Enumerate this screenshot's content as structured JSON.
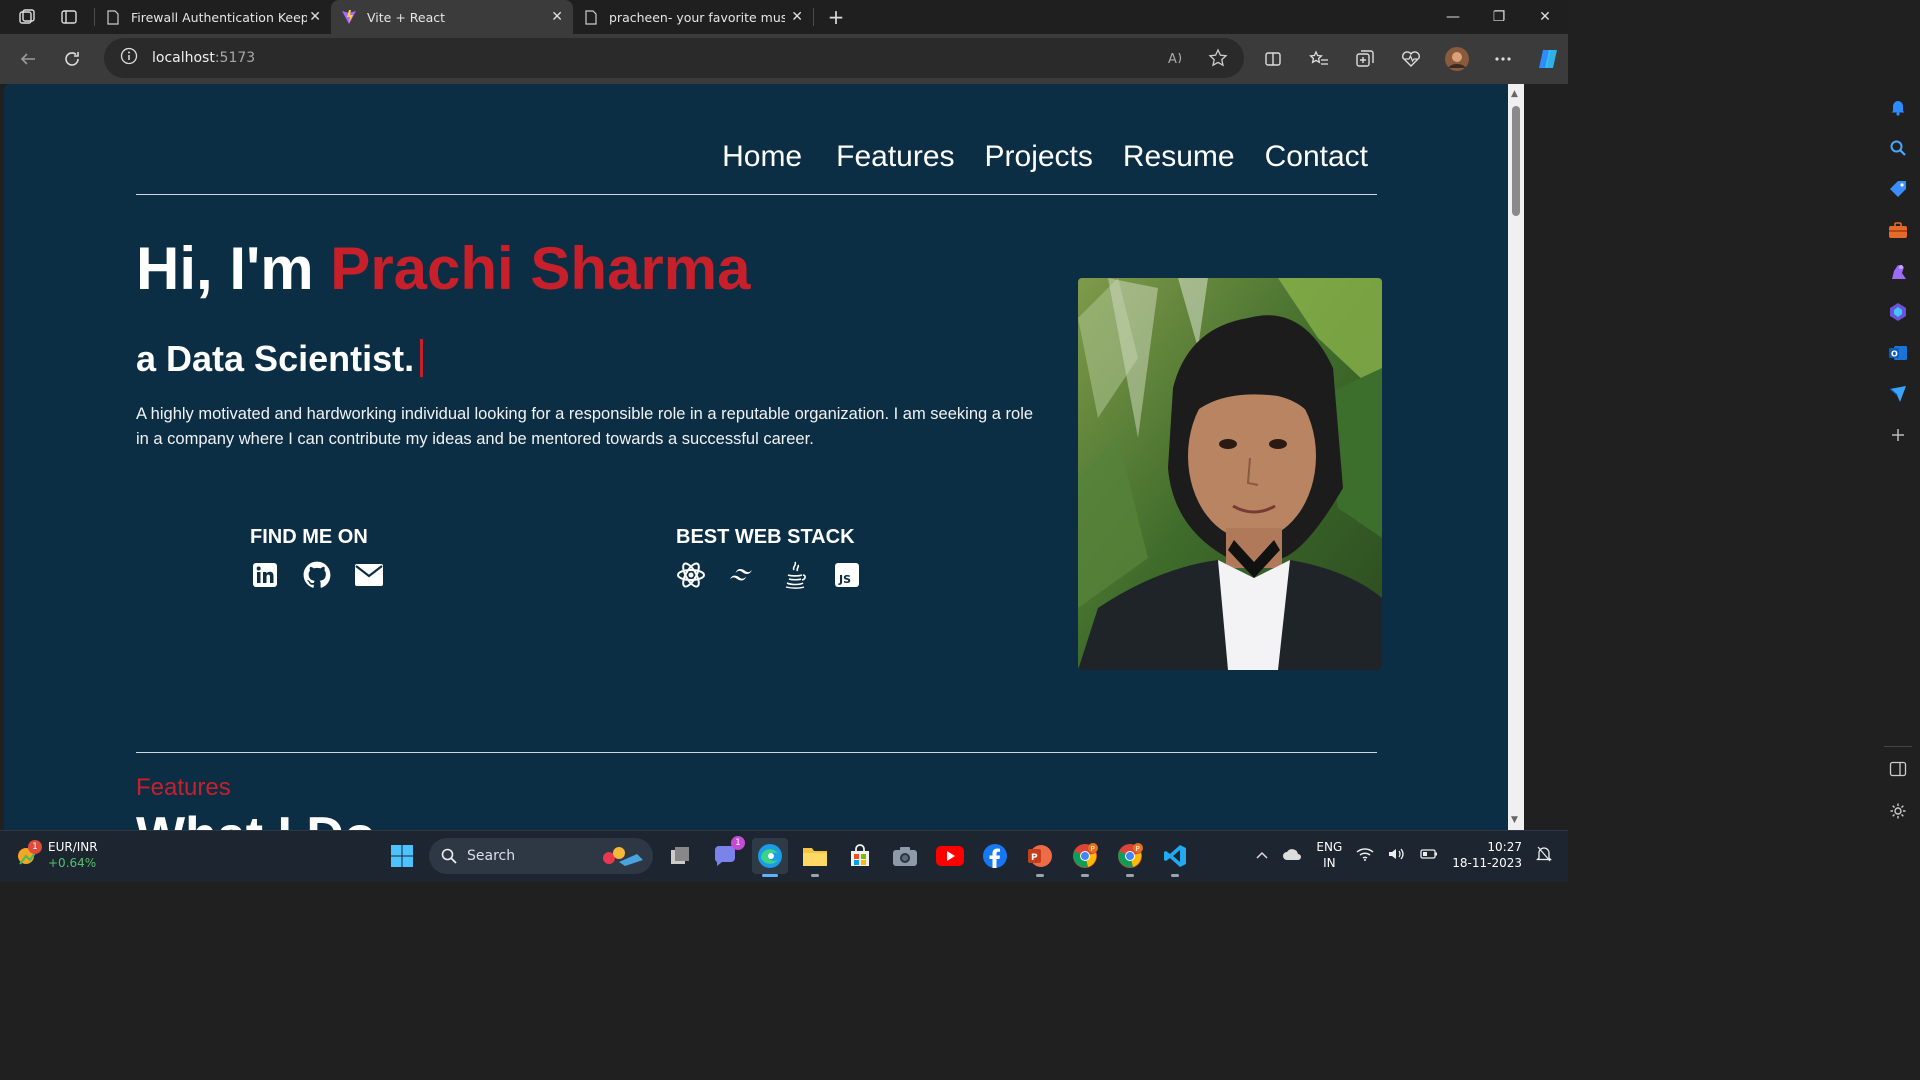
{
  "browser": {
    "tabs": [
      {
        "label": "Firewall Authentication Keepalive",
        "active": false
      },
      {
        "label": "Vite + React",
        "active": true
      },
      {
        "label": "pracheen- your favorite music is",
        "active": false
      }
    ],
    "url_host": "localhost",
    "url_port": ":5173"
  },
  "page": {
    "nav": [
      "Home",
      "Features",
      "Projects",
      "Resume",
      "Contact"
    ],
    "greeting": "Hi, I'm ",
    "name": "Prachi Sharma",
    "role": "a Data Scientist.",
    "bio": "A highly motivated and hardworking individual looking for a responsible role in a reputable organization. I am seeking a role in a company where I can contribute my ideas and be mentored towards a successful career.",
    "find_me_label": "FIND ME ON",
    "stack_label": "BEST WEB STACK",
    "features_label": "Features",
    "features_heading": "What I Do"
  },
  "taskbar": {
    "widget_title": "EUR/INR",
    "widget_change": "+0.64%",
    "widget_badge": "1",
    "search_placeholder": "Search",
    "teams_badge": "1",
    "lang_top": "ENG",
    "lang_bottom": "IN",
    "time": "10:27",
    "date": "18-11-2023"
  },
  "colors": {
    "page_bg": "#0b2e45",
    "accent_red": "#c8202a"
  }
}
